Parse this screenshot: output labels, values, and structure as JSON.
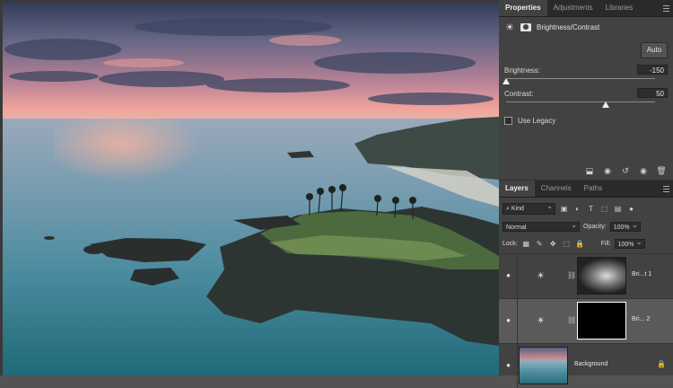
{
  "properties_panel": {
    "tabs": [
      "Properties",
      "Adjustments",
      "Libraries"
    ],
    "adjustment_name": "Brightness/Contrast",
    "auto_label": "Auto",
    "brightness_label": "Brightness:",
    "brightness_value": "-150",
    "brightness_level": -150,
    "contrast_label": "Contrast:",
    "contrast_value": "50",
    "contrast_level": 50,
    "use_legacy_label": "Use Legacy",
    "use_legacy_checked": false,
    "footer_icons": [
      "clip-to-layer-icon",
      "view-previous-icon",
      "reset-icon",
      "visibility-icon",
      "delete-icon"
    ]
  },
  "layers_panel": {
    "tabs": [
      "Layers",
      "Channels",
      "Paths"
    ],
    "filter_kind": "Kind",
    "blend_mode": "Normal",
    "opacity_label": "Opacity:",
    "opacity_value": "100%",
    "lock_label": "Lock:",
    "fill_label": "Fill:",
    "fill_value": "100%",
    "layers": [
      {
        "name": "Bri...t 1",
        "type": "brightness-contrast",
        "visible": true,
        "selected": false
      },
      {
        "name": "Bri... 2",
        "type": "brightness-contrast",
        "visible": true,
        "selected": true
      },
      {
        "name": "Background",
        "type": "image",
        "visible": true,
        "locked": true,
        "selected": false
      }
    ]
  },
  "colors": {
    "panel_bg": "#424242",
    "tabbar_bg": "#2a2a2a",
    "selected_layer": "#5a5a5a"
  }
}
